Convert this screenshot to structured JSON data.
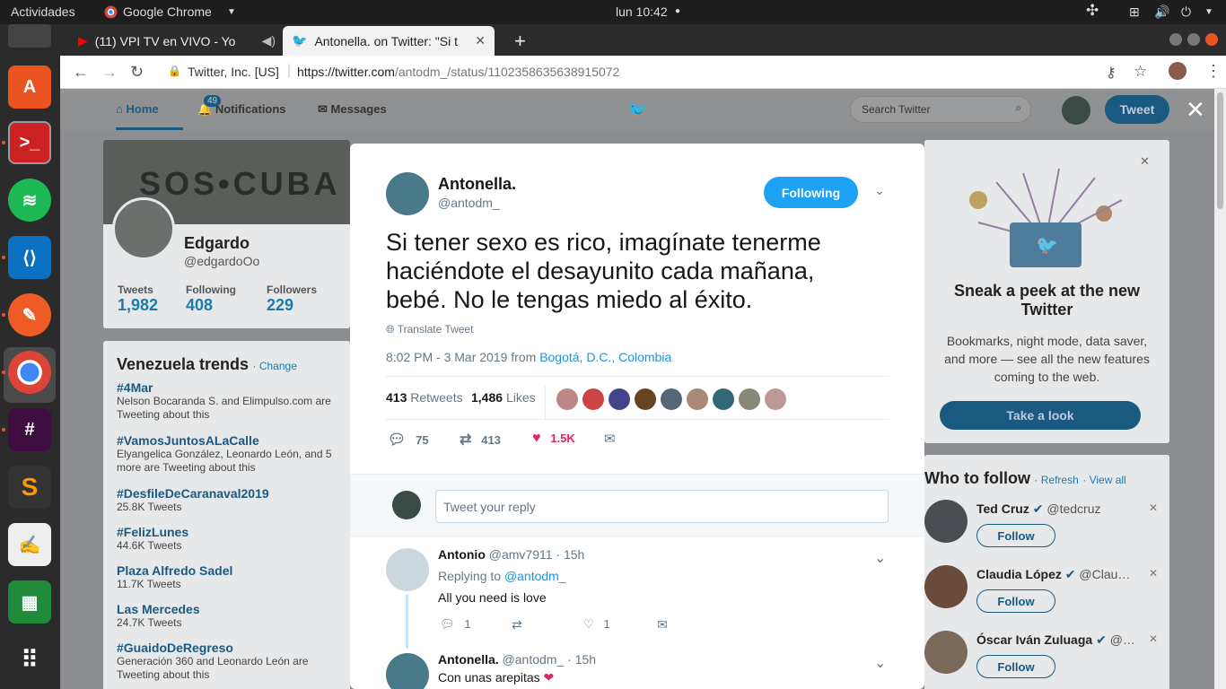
{
  "topbar": {
    "activities": "Actividades",
    "app": "Google Chrome",
    "clock": "lun 10:42"
  },
  "tabs": [
    {
      "label": "(11) VPI TV en VIVO - Yo"
    },
    {
      "label": "Antonella. on Twitter: \"Si t"
    }
  ],
  "address": {
    "site": "Twitter, Inc. [US]",
    "url_host": "https://twitter.com",
    "url_path": "/antodm_/status/1102358635638915072"
  },
  "nav": {
    "home": "Home",
    "notifications": "Notifications",
    "notif_count": "49",
    "messages": "Messages",
    "search_placeholder": "Search Twitter",
    "tweet_button": "Tweet"
  },
  "profile": {
    "name": "Edgardo",
    "handle": "@edgardoOo",
    "banner_text": "SOS•CUBA",
    "stats": [
      {
        "label": "Tweets",
        "value": "1,982"
      },
      {
        "label": "Following",
        "value": "408"
      },
      {
        "label": "Followers",
        "value": "229"
      }
    ]
  },
  "trends": {
    "title": "Venezuela trends",
    "change": "· Change",
    "items": [
      {
        "tag": "#4Mar",
        "desc": "Nelson Bocaranda S. and Elimpulso.com are Tweeting about this"
      },
      {
        "tag": "#VamosJuntosALaCalle",
        "desc": "Elyangelica González, Leonardo León, and 5 more are Tweeting about this"
      },
      {
        "tag": "#DesfileDeCaranaval2019",
        "desc": "25.8K Tweets"
      },
      {
        "tag": "#FelizLunes",
        "desc": "44.6K Tweets"
      },
      {
        "tag": "Plaza Alfredo Sadel",
        "desc": "11.7K Tweets"
      },
      {
        "tag": "Las Mercedes",
        "desc": "24.7K Tweets"
      },
      {
        "tag": "#GuaidoDeRegreso",
        "desc": "Generación 360 and Leonardo León are Tweeting about this"
      }
    ]
  },
  "tweet": {
    "name": "Antonella.",
    "handle": "@antodm_",
    "following": "Following",
    "text": "Si tener sexo es rico, imagínate tenerme haciéndote el desayunito cada mañana, bebé. No le tengas miedo al éxito.",
    "translate": "Translate Tweet",
    "time": "8:02 PM - 3 Mar 2019 from ",
    "location": "Bogotá, D.C., Colombia",
    "retweets_count": "413",
    "retweets_label": "Retweets",
    "likes_count": "1,486",
    "likes_label": "Likes",
    "reply_count": "75",
    "rt_count": "413",
    "like_count": "1.5K",
    "reply_placeholder": "Tweet your reply"
  },
  "replies": [
    {
      "name": "Antonio",
      "handle": "@amv7911",
      "time": "· 15h",
      "replying": "Replying to ",
      "replying_to": "@antodm_",
      "text": "All you need is love",
      "reply_count": "1",
      "like_count": "1"
    },
    {
      "name": "Antonella.",
      "handle": "@antodm_",
      "time": "· 15h",
      "text": "Con unas arepitas"
    }
  ],
  "promo": {
    "title": "Sneak a peek at the new Twitter",
    "body": "Bookmarks, night mode, data saver, and more — see all the new features coming to the web.",
    "button": "Take a look"
  },
  "who": {
    "title": "Who to follow",
    "refresh": "· Refresh",
    "viewall": "· View all",
    "follow": "Follow",
    "people": [
      {
        "name": "Ted Cruz",
        "handle": "@tedcruz"
      },
      {
        "name": "Claudia López",
        "handle": "@Clau…"
      },
      {
        "name": "Óscar Iván Zuluaga",
        "handle": "@…"
      }
    ]
  },
  "colors": {
    "twitter_blue": "#1da1f2",
    "like_red": "#e0245e",
    "ubuntu_orange": "#e95420"
  }
}
